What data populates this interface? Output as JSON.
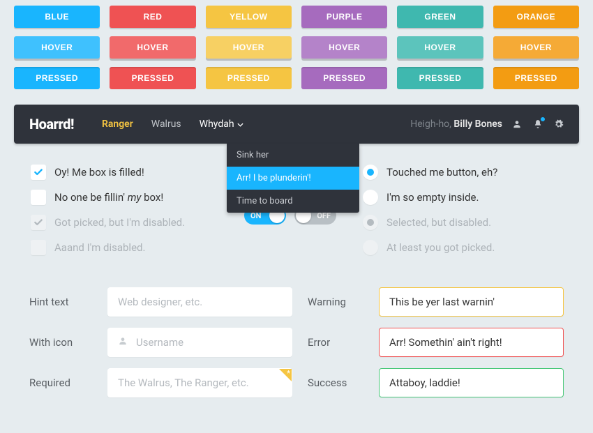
{
  "colors": {
    "blue": "#19b5fe",
    "red": "#ef5253",
    "yellow": "#f5c542",
    "purple": "#a66bbe",
    "green": "#3fb8af",
    "orange": "#f39c12",
    "blue_hover": "#3fc1fe",
    "red_hover": "#f16a6b",
    "yellow_hover": "#f7d063",
    "purple_hover": "#b483c9",
    "green_hover": "#5cc4bc",
    "orange_hover": "#f5aa36"
  },
  "buttons": {
    "row1": [
      "BLUE",
      "RED",
      "YELLOW",
      "PURPLE",
      "GREEN",
      "ORANGE"
    ],
    "row2_label": "HOVER",
    "row3_label": "PRESSED"
  },
  "nav": {
    "brand": "Hoarrd!",
    "links": [
      "Ranger",
      "Walrus",
      "Whydah"
    ],
    "greeting_prefix": "Heigh-ho, ",
    "greeting_name": "Billy Bones"
  },
  "dropdown": {
    "items": [
      "Sink her",
      "Arr! I be plunderin'!",
      "Time to board"
    ]
  },
  "checkboxes": [
    {
      "label": "Oy! Me box is filled!",
      "checked": true,
      "disabled": false
    },
    {
      "label_html": "No one be fillin' <em>my</em> box!",
      "checked": false,
      "disabled": false
    },
    {
      "label": "Got picked, but I'm disabled.",
      "checked": true,
      "disabled": true
    },
    {
      "label": "Aaand I'm disabled.",
      "checked": false,
      "disabled": true
    }
  ],
  "radios": [
    {
      "label": "Touched me button, eh?",
      "selected": true,
      "disabled": false
    },
    {
      "label": "I'm so empty inside.",
      "selected": false,
      "disabled": false
    },
    {
      "label": "Selected, but disabled.",
      "selected": true,
      "disabled": true
    },
    {
      "label": "At least you got picked.",
      "selected": false,
      "disabled": true
    }
  ],
  "toggles": {
    "on": "ON",
    "off": "OFF"
  },
  "form": {
    "hint_label": "Hint text",
    "hint_placeholder": "Web designer, etc.",
    "icon_label": "With icon",
    "icon_placeholder": "Username",
    "required_label": "Required",
    "required_placeholder": "The Walrus, The Ranger, etc.",
    "warning_label": "Warning",
    "warning_value": "This be yer last warnin'",
    "error_label": "Error",
    "error_value": "Arr! Somethin' ain't right!",
    "success_label": "Success",
    "success_value": "Attaboy, laddie!"
  }
}
